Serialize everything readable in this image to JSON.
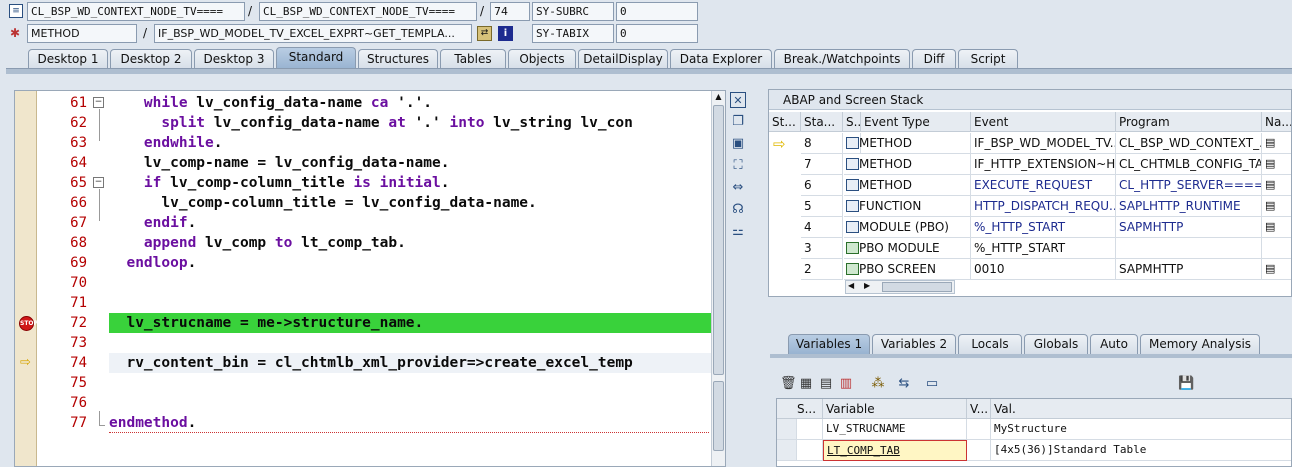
{
  "header": {
    "row1": {
      "class_field": "CL_BSP_WD_CONTEXT_NODE_TV====",
      "sep1": "/",
      "include_field": "CL_BSP_WD_CONTEXT_NODE_TV====",
      "sep2": "/",
      "line_field": "74",
      "sysfield_name": "SY-SUBRC",
      "sysfield_value": "0"
    },
    "row2": {
      "type_field": "METHOD",
      "sep1": "/",
      "method_field": "IF_BSP_WD_MODEL_TV_EXCEL_EXPRT~GET_TEMPLA...",
      "sysfield_name": "SY-TABIX",
      "sysfield_value": "0"
    }
  },
  "tabs": [
    "Desktop 1",
    "Desktop 2",
    "Desktop 3",
    "Standard",
    "Structures",
    "Tables",
    "Objects",
    "DetailDisplay",
    "Data Explorer",
    "Break./Watchpoints",
    "Diff",
    "Script"
  ],
  "active_tab": "Standard",
  "code": {
    "lines": [
      {
        "num": "61",
        "text": "    while lv_config_data-name ca '.'."
      },
      {
        "num": "62",
        "text": "      split lv_config_data-name at '.' into lv_string lv_con"
      },
      {
        "num": "63",
        "text": "    endwhile."
      },
      {
        "num": "64",
        "text": "    lv_comp-name = lv_config_data-name."
      },
      {
        "num": "65",
        "text": "    if lv_comp-column_title is initial."
      },
      {
        "num": "66",
        "text": "      lv_comp-column_title = lv_config_data-name."
      },
      {
        "num": "67",
        "text": "    endif."
      },
      {
        "num": "68",
        "text": "    append lv_comp to lt_comp_tab."
      },
      {
        "num": "69",
        "text": "  endloop."
      },
      {
        "num": "70",
        "text": ""
      },
      {
        "num": "71",
        "text": ""
      },
      {
        "num": "72",
        "text": "  lv_strucname = me->structure_name."
      },
      {
        "num": "73",
        "text": ""
      },
      {
        "num": "74",
        "text": "  rv_content_bin = cl_chtmlb_xml_provider=>create_excel_temp"
      },
      {
        "num": "75",
        "text": ""
      },
      {
        "num": "76",
        "text": ""
      },
      {
        "num": "77",
        "text": "endmethod."
      }
    ]
  },
  "stack": {
    "title": "ABAP and Screen Stack",
    "columns": [
      "St...",
      "Sta...",
      "S...",
      "Event Type",
      "Event",
      "Program",
      "Na..."
    ],
    "rows": [
      {
        "level": "8",
        "type": "METHOD",
        "event": "IF_BSP_WD_MODEL_TV...",
        "program": "CL_BSP_WD_CONTEXT_..."
      },
      {
        "level": "7",
        "type": "METHOD",
        "event": "IF_HTTP_EXTENSION~H...",
        "program": "CL_CHTMLB_CONFIG_TA..."
      },
      {
        "level": "6",
        "type": "METHOD",
        "event": "EXECUTE_REQUEST",
        "program": "CL_HTTP_SERVER===="
      },
      {
        "level": "5",
        "type": "FUNCTION",
        "event": "HTTP_DISPATCH_REQU...",
        "program": "SAPLHTTP_RUNTIME"
      },
      {
        "level": "4",
        "type": "MODULE (PBO)",
        "event": "%_HTTP_START",
        "program": "SAPMHTTP"
      },
      {
        "level": "3",
        "type": "PBO MODULE",
        "event": "%_HTTP_START",
        "program": ""
      },
      {
        "level": "2",
        "type": "PBO SCREEN",
        "event": "0010",
        "program": "SAPMHTTP"
      }
    ]
  },
  "var_tabs": [
    "Variables 1",
    "Variables 2",
    "Locals",
    "Globals",
    "Auto",
    "Memory Analysis"
  ],
  "variables": {
    "columns": [
      "S...",
      "Variable",
      "V...",
      "Val."
    ],
    "rows": [
      {
        "name": "LV_STRUCNAME",
        "value": "MyStructure"
      },
      {
        "name": "LT_COMP_TAB",
        "value": "[4x5(36)]Standard Table"
      }
    ]
  },
  "colors": {
    "breakpoint_line": "#39d23b",
    "current_line": "#eef2f7",
    "active_tab": "#a9c1dc"
  }
}
